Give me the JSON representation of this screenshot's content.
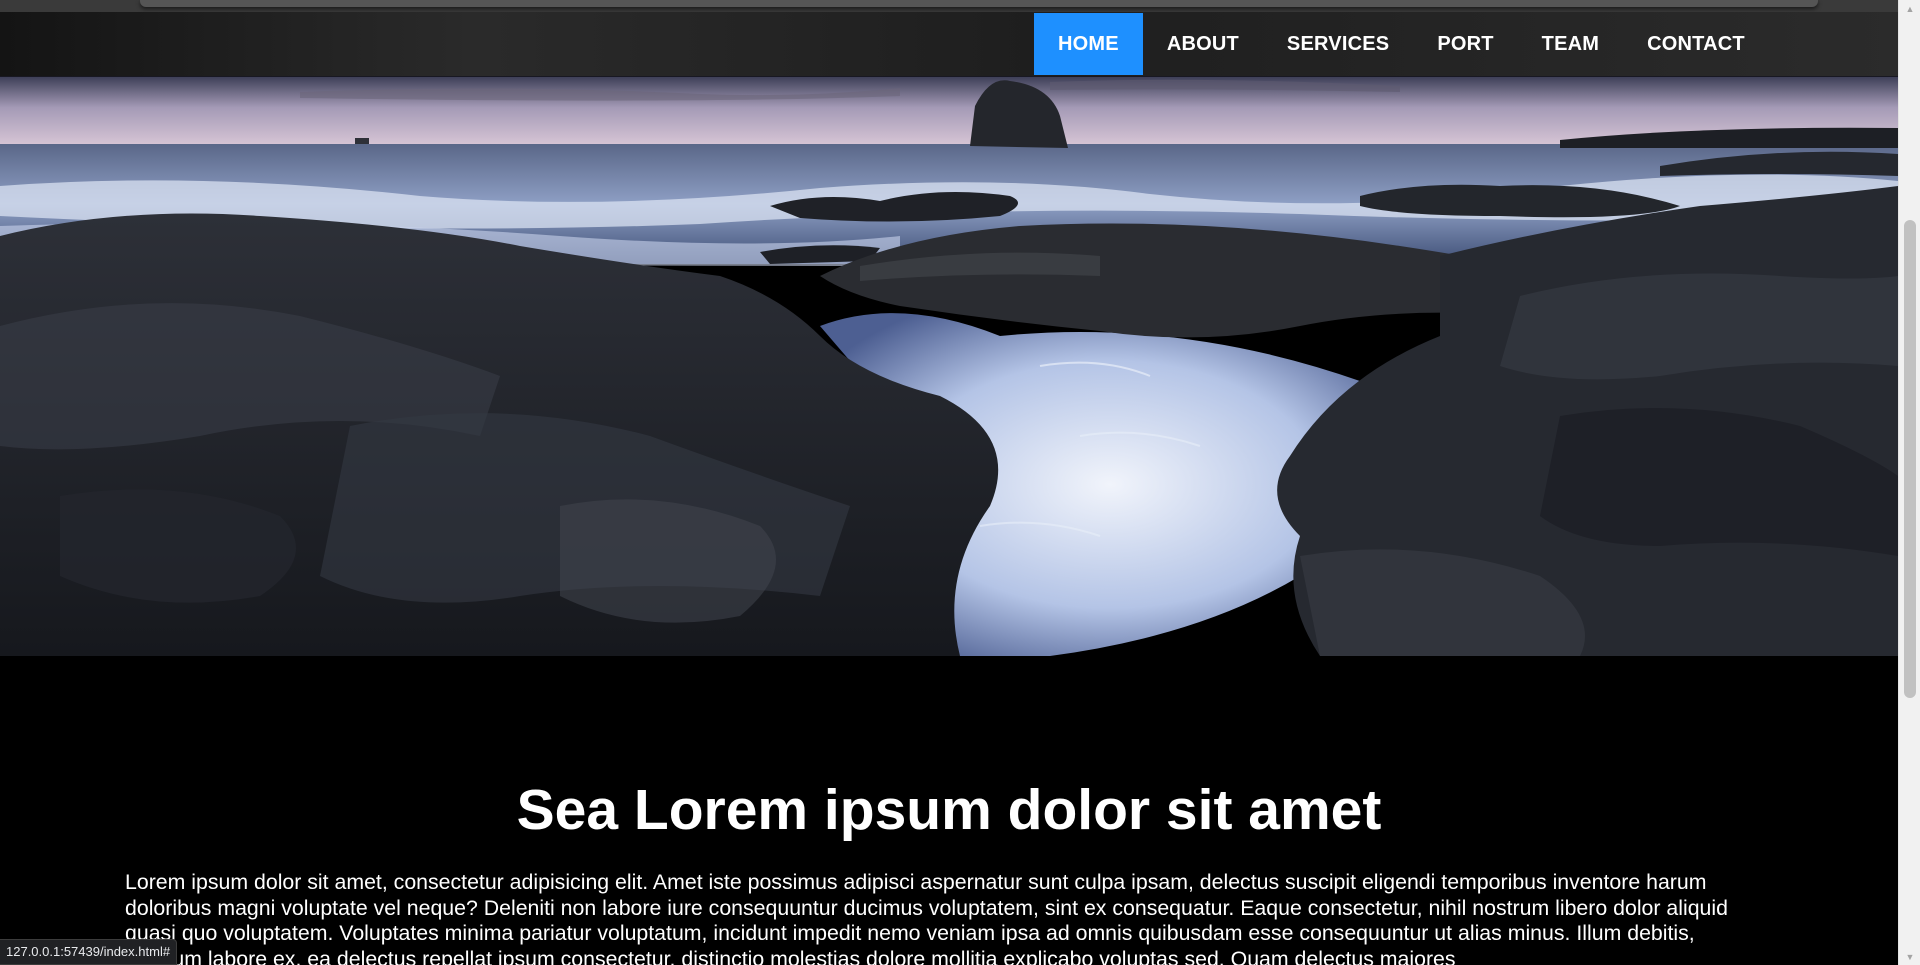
{
  "navbar": {
    "items": [
      {
        "label": "HOME",
        "active": true
      },
      {
        "label": "ABOUT"
      },
      {
        "label": "SERVICES"
      },
      {
        "label": "PORT"
      },
      {
        "label": "TEAM"
      },
      {
        "label": "CONTACT"
      }
    ],
    "active_color": "#1e90ff"
  },
  "hero": {
    "image": "rocky-sea-coast-photo"
  },
  "section": {
    "heading": "Sea Lorem ipsum dolor sit amet",
    "paragraph": "Lorem ipsum dolor sit amet, consectetur adipisicing elit. Amet iste possimus adipisci aspernatur sunt culpa ipsam, delectus suscipit eligendi temporibus inventore harum doloribus magni voluptate vel neque? Deleniti non labore iure consequuntur ducimus voluptatem, sint ex consequatur. Eaque consectetur, nihil nostrum libero dolor aliquid quasi quo voluptatem. Voluptates minima pariatur voluptatum, incidunt impedit nemo veniam ipsa ad omnis quibusdam esse consequuntur ut alias minus. Illum debitis, nostrum labore ex, ea delectus repellat ipsum consectetur, distinctio molestias dolore mollitia explicabo voluptas sed. Quam delectus maiores"
  },
  "status_bar": {
    "url": "127.0.0.1:57439/index.html#"
  }
}
